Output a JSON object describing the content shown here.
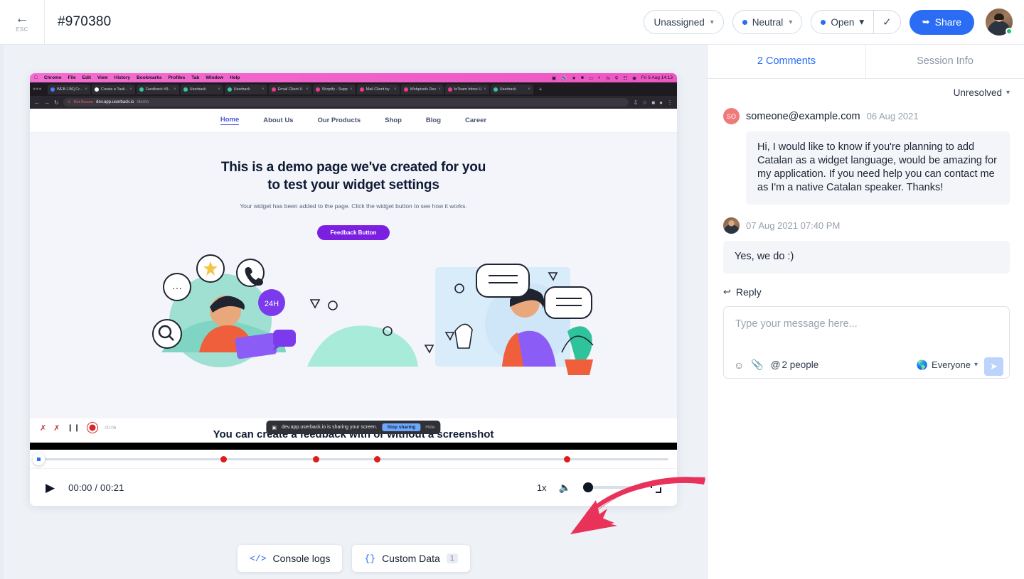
{
  "topbar": {
    "esc_label": "ESC",
    "ticket_id": "#970380",
    "assignee": "Unassigned",
    "priority": "Neutral",
    "status": "Open",
    "share_label": "Share"
  },
  "viewer": {
    "recording": {
      "menubar": {
        "apple": "",
        "items": [
          "Chrome",
          "File",
          "Edit",
          "View",
          "History",
          "Bookmarks",
          "Profiles",
          "Tab",
          "Window",
          "Help"
        ],
        "clock": "Fri 6 Aug  14:13"
      },
      "tabs": [
        {
          "title": "WEB-196] Cr...",
          "color": "#4a7cf7"
        },
        {
          "title": "Create a Task -",
          "color": "#ffffff"
        },
        {
          "title": "Feedback #9...",
          "color": "#36c3a0"
        },
        {
          "title": "Userback",
          "color": "#36c3a0"
        },
        {
          "title": "Userback",
          "color": "#36c3a0"
        },
        {
          "title": "Email Client U",
          "color": "#ef3a8f"
        },
        {
          "title": "Shopify - Supp",
          "color": "#ef3a8f"
        },
        {
          "title": "Mail Client by",
          "color": "#ef3a8f"
        },
        {
          "title": "Webpixels Dev",
          "color": "#ef3a8f"
        },
        {
          "title": "InTeam Inbox U",
          "color": "#ef3a8f"
        },
        {
          "title": "Userback",
          "color": "#36c3a0"
        }
      ],
      "url_warning": "Not Secure",
      "url_domain": "dev.app.userback.io",
      "url_path": "/demo",
      "nav": [
        "Home",
        "About Us",
        "Our Products",
        "Shop",
        "Blog",
        "Career"
      ],
      "hero_title_line1": "This is a demo page we've created for you",
      "hero_title_line2": "to test your widget settings",
      "hero_sub": "Your widget has been added to the page. Click the widget button to see how it works.",
      "widget_button": "Feedback Button",
      "foot_title": "You can create a feedback with or without a screenshot",
      "sharing_text": "dev.app.userback.io is sharing your screen.",
      "sharing_stop": "Stop sharing",
      "sharing_hide": "Hide",
      "rec_timer": "00:06"
    },
    "player": {
      "current_time": "00:00",
      "duration": "00:21",
      "time_display": "00:00 / 00:21",
      "speed": "1x",
      "playhead_percent": 0,
      "volume_percent": 0,
      "markers_percent": [
        29.5,
        43.7,
        53.2,
        82.5
      ]
    },
    "bottom_buttons": [
      {
        "label": "Console logs",
        "icon": "</>",
        "badge": ""
      },
      {
        "label": "Custom Data",
        "icon": "{}",
        "badge": "1"
      }
    ],
    "annotation_arrow_color": "#e8325a"
  },
  "side": {
    "tabs": [
      {
        "label": "2 Comments",
        "active": true
      },
      {
        "label": "Session Info",
        "active": false
      }
    ],
    "resolve_filter": "Unresolved",
    "comments": [
      {
        "initials": "SO",
        "author": "someone@example.com",
        "date": "06 Aug 2021",
        "text": "Hi, I would like to know if you're planning to add Catalan as a widget language, would be amazing for my application. If you need help you can contact me as I'm a native Catalan speaker. Thanks!"
      },
      {
        "initials": "",
        "author": "",
        "date": "07 Aug 2021 07:40 PM",
        "text": "Yes, we do :)"
      }
    ],
    "reply_label": "Reply",
    "composer": {
      "placeholder": "Type your message here...",
      "mention_label": "2 people",
      "visibility": "Everyone"
    }
  },
  "colors": {
    "accent": "#2a6df4",
    "widget_purple": "#7b1fe0",
    "marker_red": "#e01b1b",
    "arrow_red": "#e8325a",
    "avatar_salmon": "#f07a7a"
  }
}
